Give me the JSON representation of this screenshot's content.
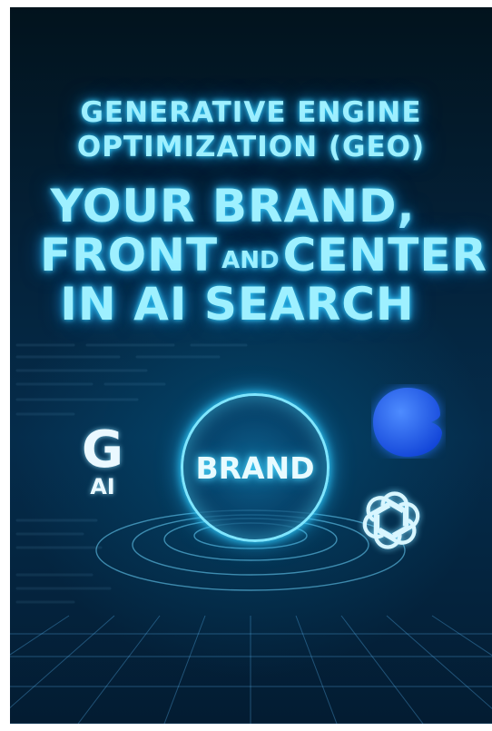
{
  "headline": {
    "kicker_line1": "GENERATIVE ENGINE",
    "kicker_line2": "OPTIMIZATION (GEO)",
    "line1": "YOUR BRAND,",
    "line2_a": "FRONT",
    "line2_and": "AND",
    "line2_b": "CENTER",
    "line3": "IN AI SEARCH"
  },
  "google_logo": {
    "letter": "G",
    "sub": "AI"
  },
  "brand_orb": {
    "label": "BRAND"
  },
  "icons": [
    "google-ai-icon",
    "chat-bubble-icon",
    "openai-icon"
  ],
  "colors": {
    "glow": "#9ef0ff",
    "background": "#052c4b",
    "bubble_blue": "#1f6bff"
  }
}
